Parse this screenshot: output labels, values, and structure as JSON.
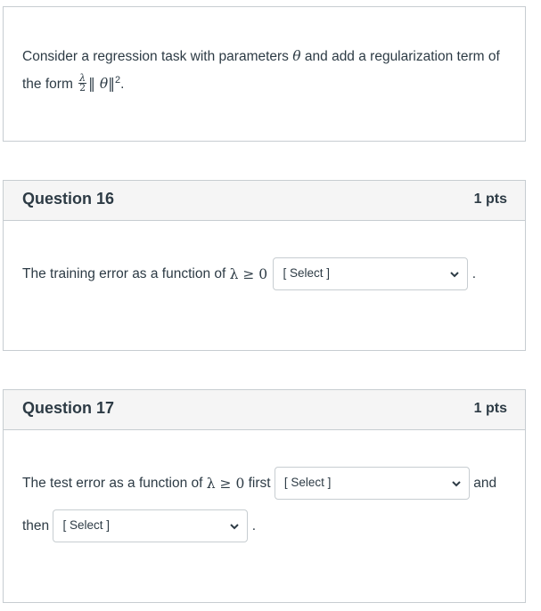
{
  "intro": {
    "text_before": "Consider a regression task with parameters ",
    "theta": "θ",
    "text_mid": " and add a regularization term of the form ",
    "lambda": "λ",
    "two": "2",
    "norm_open": "‖ ",
    "norm_close": "‖",
    "exp": "2",
    "period": "."
  },
  "q16": {
    "title": "Question 16",
    "points": "1 pts",
    "text": "The training error as a function of ",
    "math": "λ ≥ 0",
    "select": "[ Select ]",
    "after": "."
  },
  "q17": {
    "title": "Question 17",
    "points": "1 pts",
    "text": "The test error as a function of ",
    "math": "λ ≥ 0",
    "first": " first",
    "select1": "[ Select ]",
    "and": "and",
    "then": "then",
    "select2": "[ Select ]",
    "after": "."
  },
  "icons": {
    "dropdown": "chevron-down-icon"
  }
}
